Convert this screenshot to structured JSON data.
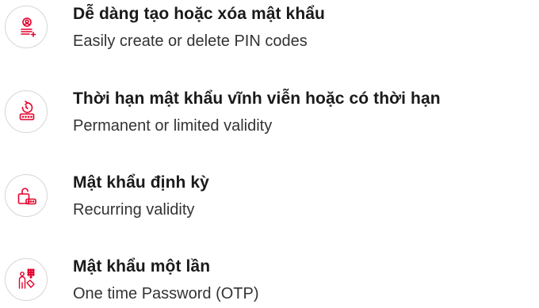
{
  "accent_color": "#e4002b",
  "features": [
    {
      "icon": "add-remove-user-list-icon",
      "title": "Dễ dàng tạo hoặc xóa mật khẩu",
      "subtitle": "Easily create or delete PIN codes"
    },
    {
      "icon": "timer-keypad-icon",
      "title": "Thời hạn mật khẩu vĩnh viễn hoặc có thời hạn",
      "subtitle": "Permanent or limited validity"
    },
    {
      "icon": "lock-keypad-icon",
      "title": "Mật khẩu định kỳ",
      "subtitle": "Recurring validity"
    },
    {
      "icon": "person-keypad-icon",
      "title": "Mật khẩu một lần",
      "subtitle": "One time Password (OTP)"
    }
  ]
}
